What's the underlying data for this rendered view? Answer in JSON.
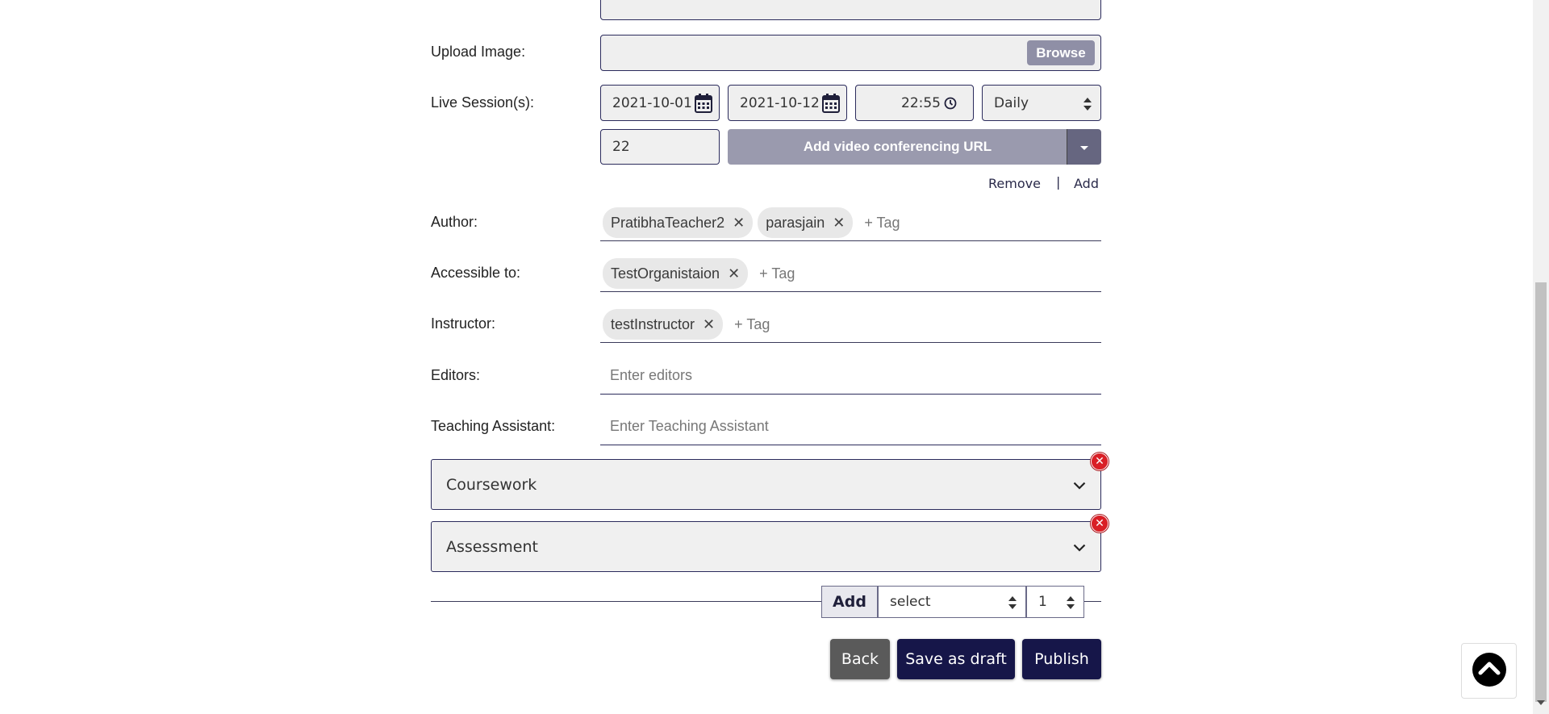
{
  "form": {
    "upload_image": {
      "label": "Upload Image:",
      "browse_label": "Browse"
    },
    "live_sessions": {
      "label": "Live Session(s):",
      "start_date": "2021-10-01",
      "end_date": "2021-10-12",
      "time": "22:55",
      "frequency": "Daily",
      "duration": "22",
      "video_url_label": "Add video conferencing URL",
      "remove_label": "Remove",
      "separator": "|",
      "add_label": "Add"
    },
    "author": {
      "label": "Author:",
      "tags": [
        "PratibhaTeacher2",
        "parasjain"
      ],
      "placeholder": "+ Tag"
    },
    "accessible_to": {
      "label": "Accessible to:",
      "tags": [
        "TestOrganistaion"
      ],
      "placeholder": "+ Tag"
    },
    "instructor": {
      "label": "Instructor:",
      "tags": [
        "testInstructor"
      ],
      "placeholder": "+ Tag"
    },
    "editors": {
      "label": "Editors:",
      "placeholder": "Enter editors"
    },
    "teaching_assistant": {
      "label": "Teaching Assistant:",
      "placeholder": "Enter Teaching Assistant"
    }
  },
  "sections": [
    {
      "title": "Coursework"
    },
    {
      "title": "Assessment"
    }
  ],
  "add_section": {
    "add_label": "Add",
    "type_value": "select",
    "count_value": "1"
  },
  "actions": {
    "back": "Back",
    "save_draft": "Save as draft",
    "publish": "Publish"
  },
  "icons": {
    "calendar": "calendar-icon",
    "clock": "clock-icon",
    "sort": "sort-arrows-icon",
    "caret": "caret-down-icon",
    "close": "close-icon",
    "chevron": "chevron-down-icon",
    "remove": "remove-circle-icon",
    "scroll_top": "scroll-to-top-icon"
  },
  "colors": {
    "navy": "#161649",
    "red": "#d91f26",
    "gray_button": "#8f8fa6",
    "field_bg": "#efefef"
  }
}
